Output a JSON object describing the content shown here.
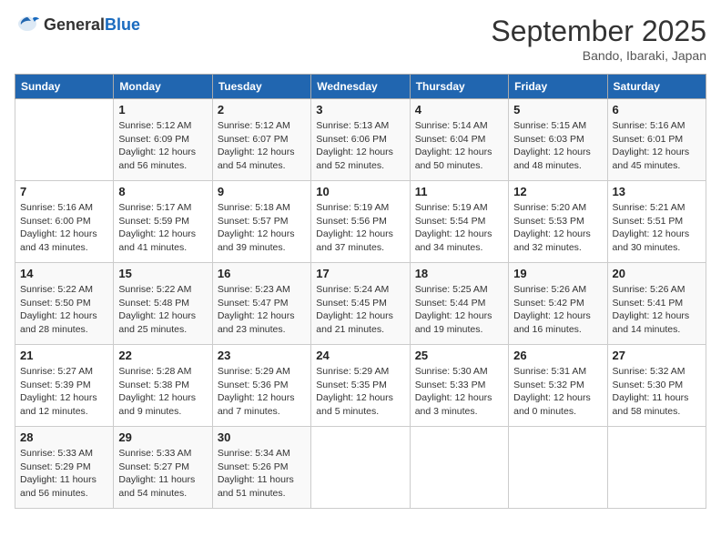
{
  "header": {
    "logo_general": "General",
    "logo_blue": "Blue",
    "month_year": "September 2025",
    "location": "Bando, Ibaraki, Japan"
  },
  "days_of_week": [
    "Sunday",
    "Monday",
    "Tuesday",
    "Wednesday",
    "Thursday",
    "Friday",
    "Saturday"
  ],
  "weeks": [
    [
      {
        "day": "",
        "info": ""
      },
      {
        "day": "1",
        "info": "Sunrise: 5:12 AM\nSunset: 6:09 PM\nDaylight: 12 hours\nand 56 minutes."
      },
      {
        "day": "2",
        "info": "Sunrise: 5:12 AM\nSunset: 6:07 PM\nDaylight: 12 hours\nand 54 minutes."
      },
      {
        "day": "3",
        "info": "Sunrise: 5:13 AM\nSunset: 6:06 PM\nDaylight: 12 hours\nand 52 minutes."
      },
      {
        "day": "4",
        "info": "Sunrise: 5:14 AM\nSunset: 6:04 PM\nDaylight: 12 hours\nand 50 minutes."
      },
      {
        "day": "5",
        "info": "Sunrise: 5:15 AM\nSunset: 6:03 PM\nDaylight: 12 hours\nand 48 minutes."
      },
      {
        "day": "6",
        "info": "Sunrise: 5:16 AM\nSunset: 6:01 PM\nDaylight: 12 hours\nand 45 minutes."
      }
    ],
    [
      {
        "day": "7",
        "info": "Sunrise: 5:16 AM\nSunset: 6:00 PM\nDaylight: 12 hours\nand 43 minutes."
      },
      {
        "day": "8",
        "info": "Sunrise: 5:17 AM\nSunset: 5:59 PM\nDaylight: 12 hours\nand 41 minutes."
      },
      {
        "day": "9",
        "info": "Sunrise: 5:18 AM\nSunset: 5:57 PM\nDaylight: 12 hours\nand 39 minutes."
      },
      {
        "day": "10",
        "info": "Sunrise: 5:19 AM\nSunset: 5:56 PM\nDaylight: 12 hours\nand 37 minutes."
      },
      {
        "day": "11",
        "info": "Sunrise: 5:19 AM\nSunset: 5:54 PM\nDaylight: 12 hours\nand 34 minutes."
      },
      {
        "day": "12",
        "info": "Sunrise: 5:20 AM\nSunset: 5:53 PM\nDaylight: 12 hours\nand 32 minutes."
      },
      {
        "day": "13",
        "info": "Sunrise: 5:21 AM\nSunset: 5:51 PM\nDaylight: 12 hours\nand 30 minutes."
      }
    ],
    [
      {
        "day": "14",
        "info": "Sunrise: 5:22 AM\nSunset: 5:50 PM\nDaylight: 12 hours\nand 28 minutes."
      },
      {
        "day": "15",
        "info": "Sunrise: 5:22 AM\nSunset: 5:48 PM\nDaylight: 12 hours\nand 25 minutes."
      },
      {
        "day": "16",
        "info": "Sunrise: 5:23 AM\nSunset: 5:47 PM\nDaylight: 12 hours\nand 23 minutes."
      },
      {
        "day": "17",
        "info": "Sunrise: 5:24 AM\nSunset: 5:45 PM\nDaylight: 12 hours\nand 21 minutes."
      },
      {
        "day": "18",
        "info": "Sunrise: 5:25 AM\nSunset: 5:44 PM\nDaylight: 12 hours\nand 19 minutes."
      },
      {
        "day": "19",
        "info": "Sunrise: 5:26 AM\nSunset: 5:42 PM\nDaylight: 12 hours\nand 16 minutes."
      },
      {
        "day": "20",
        "info": "Sunrise: 5:26 AM\nSunset: 5:41 PM\nDaylight: 12 hours\nand 14 minutes."
      }
    ],
    [
      {
        "day": "21",
        "info": "Sunrise: 5:27 AM\nSunset: 5:39 PM\nDaylight: 12 hours\nand 12 minutes."
      },
      {
        "day": "22",
        "info": "Sunrise: 5:28 AM\nSunset: 5:38 PM\nDaylight: 12 hours\nand 9 minutes."
      },
      {
        "day": "23",
        "info": "Sunrise: 5:29 AM\nSunset: 5:36 PM\nDaylight: 12 hours\nand 7 minutes."
      },
      {
        "day": "24",
        "info": "Sunrise: 5:29 AM\nSunset: 5:35 PM\nDaylight: 12 hours\nand 5 minutes."
      },
      {
        "day": "25",
        "info": "Sunrise: 5:30 AM\nSunset: 5:33 PM\nDaylight: 12 hours\nand 3 minutes."
      },
      {
        "day": "26",
        "info": "Sunrise: 5:31 AM\nSunset: 5:32 PM\nDaylight: 12 hours\nand 0 minutes."
      },
      {
        "day": "27",
        "info": "Sunrise: 5:32 AM\nSunset: 5:30 PM\nDaylight: 11 hours\nand 58 minutes."
      }
    ],
    [
      {
        "day": "28",
        "info": "Sunrise: 5:33 AM\nSunset: 5:29 PM\nDaylight: 11 hours\nand 56 minutes."
      },
      {
        "day": "29",
        "info": "Sunrise: 5:33 AM\nSunset: 5:27 PM\nDaylight: 11 hours\nand 54 minutes."
      },
      {
        "day": "30",
        "info": "Sunrise: 5:34 AM\nSunset: 5:26 PM\nDaylight: 11 hours\nand 51 minutes."
      },
      {
        "day": "",
        "info": ""
      },
      {
        "day": "",
        "info": ""
      },
      {
        "day": "",
        "info": ""
      },
      {
        "day": "",
        "info": ""
      }
    ]
  ]
}
